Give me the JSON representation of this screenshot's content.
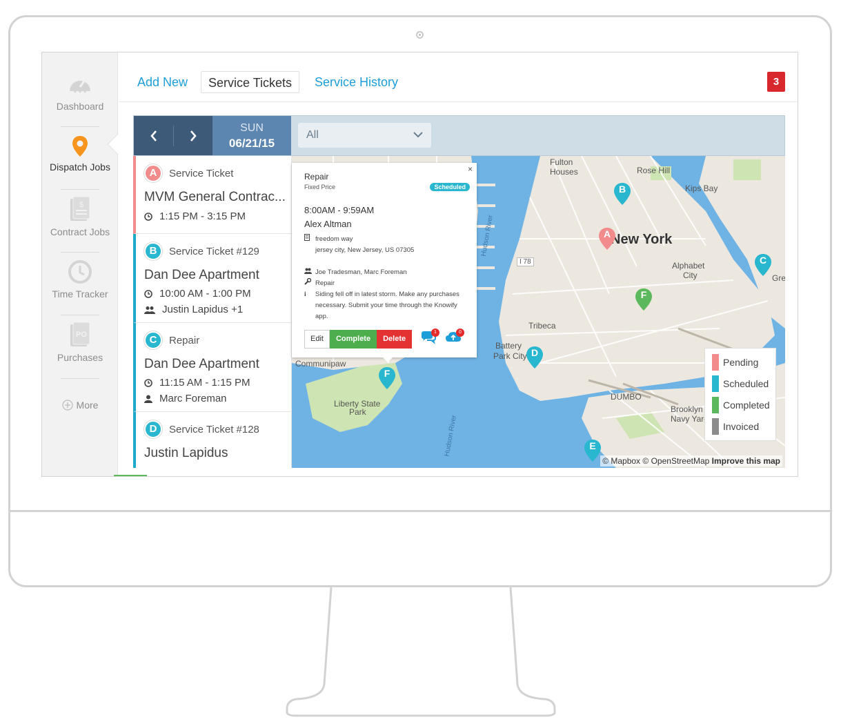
{
  "sidebar": {
    "items": [
      {
        "label": "Dashboard",
        "icon": "speedometer-icon"
      },
      {
        "label": "Dispatch Jobs",
        "icon": "map-pin-icon"
      },
      {
        "label": "Contract Jobs",
        "icon": "document-dollar-icon"
      },
      {
        "label": "Time Tracker",
        "icon": "clock-icon"
      },
      {
        "label": "Purchases",
        "icon": "purchase-order-icon"
      },
      {
        "label": "More",
        "icon": "plus-circle-icon"
      }
    ],
    "accent": "#f7941d"
  },
  "topnav": {
    "add_new": "Add New",
    "service_tickets": "Service Tickets",
    "service_history": "Service History",
    "notification_count": "3"
  },
  "datebar": {
    "day": "SUN",
    "date": "06/21/15",
    "filter_value": "All"
  },
  "tickets": [
    {
      "letter": "A",
      "type": "Service Ticket",
      "name": "MVM General Contrac...",
      "time": "1:15 PM - 3:15 PM",
      "status_color": "#f28b8b"
    },
    {
      "letter": "B",
      "type": "Service Ticket #129",
      "name": "Dan Dee Apartment",
      "time": "10:00 AM - 1:00 PM",
      "people": "Justin Lapidus +1",
      "status_color": "#29b6cf"
    },
    {
      "letter": "C",
      "type": "Repair",
      "name": "Dan Dee Apartment",
      "time": "11:15 AM - 1:15 PM",
      "people": "Marc Foreman",
      "status_color": "#29b6cf"
    },
    {
      "letter": "D",
      "type": "Service Ticket #128",
      "name": "Justin Lapidus",
      "status_color": "#29b6cf"
    }
  ],
  "popup": {
    "title": "Repair",
    "subtitle": "Fixed Price",
    "status": "Scheduled",
    "time": "8:00AM - 9:59AM",
    "person": "Alex Altman",
    "address_line1": "freedom way",
    "address_line2": "jersey city, New Jersey, US 07305",
    "crew": "Joe Tradesman, Marc Foreman",
    "job_type": "Repair",
    "notes_line1": "Siding fell off in latest storm. Make any purchases",
    "notes_line2": "necessary. Submit your time through the Knowify",
    "notes_line3": "app.",
    "edit": "Edit",
    "complete": "Complete",
    "delete": "Delete",
    "comments_count": "1",
    "uploads_count": "0",
    "close": "×"
  },
  "legend": [
    {
      "label": "Pending",
      "color": "#f28b8b"
    },
    {
      "label": "Scheduled",
      "color": "#29b6cf"
    },
    {
      "label": "Completed",
      "color": "#5cb85c"
    },
    {
      "label": "Invoiced",
      "color": "#8c8c8c"
    }
  ],
  "map": {
    "labels": {
      "fulton": "Fulton",
      "houses": "Houses",
      "rose_hill": "Rose Hill",
      "kips_bay": "Kips Bay",
      "new_york": "New York",
      "alphabet": "Alphabet",
      "city": "City",
      "tribeca": "Tribeca",
      "battery": "Battery",
      "park_city": "Park City",
      "communipaw": "Communipaw",
      "liberty": "Liberty State",
      "park": "Park",
      "dumbo": "DUMBO",
      "brooklyn": "Brooklyn",
      "navy_yard": "Navy Yard",
      "gre": "Gre",
      "hudson_river_1": "Hudson River",
      "hudson_river_2": "Hudson River",
      "i78": "I 78"
    },
    "pins": [
      {
        "letter": "A",
        "color": "#f28b8b"
      },
      {
        "letter": "B",
        "color": "#29b6cf"
      },
      {
        "letter": "C",
        "color": "#29b6cf"
      },
      {
        "letter": "D",
        "color": "#29b6cf"
      },
      {
        "letter": "E",
        "color": "#29b6cf"
      },
      {
        "letter": "F",
        "color": "#29b6cf"
      },
      {
        "letter": "F",
        "color": "#5cb85c"
      }
    ],
    "attribution_mapbox": "© Mapbox",
    "attribution_osm": "© OpenStreetMap",
    "attribution_improve": "Improve this map"
  }
}
